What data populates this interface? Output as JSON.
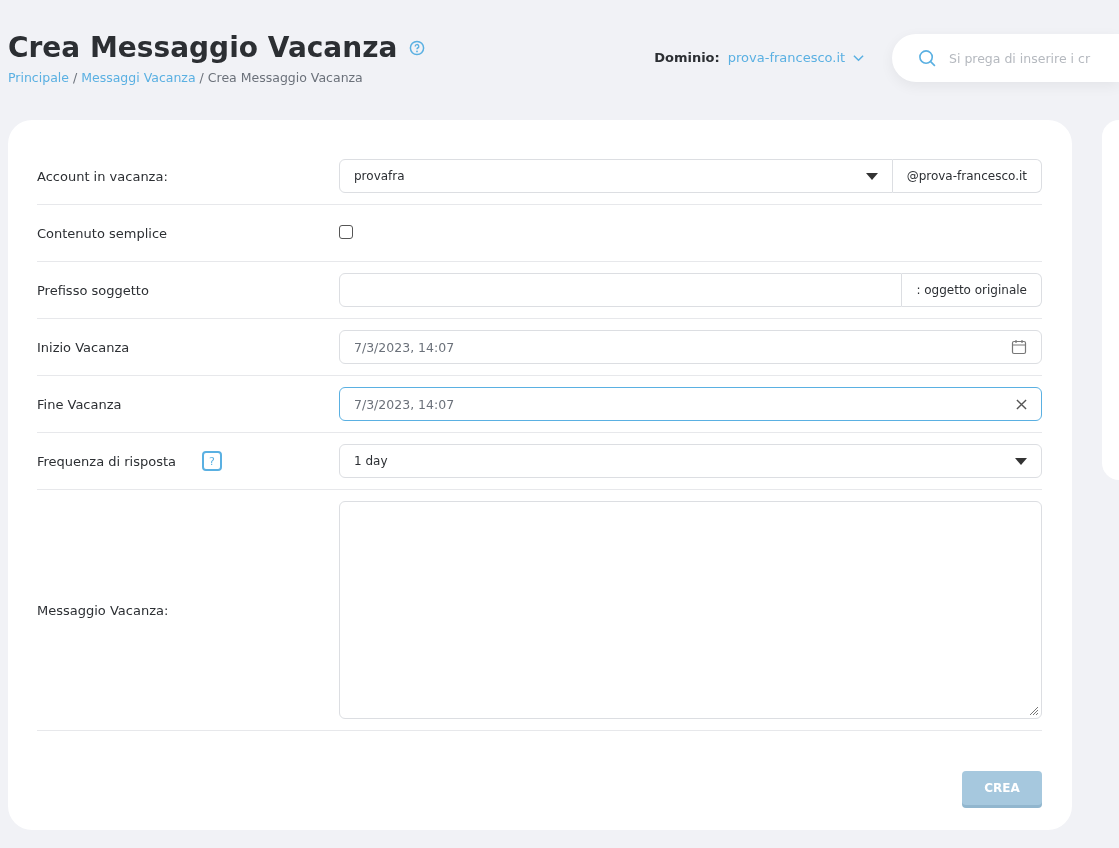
{
  "header": {
    "title": "Crea Messaggio Vacanza",
    "breadcrumbs": [
      {
        "label": "Principale",
        "link": true
      },
      {
        "separator": "/",
        "label": "Messaggi Vacanza",
        "link": true
      },
      {
        "separator": "/",
        "label": "Crea Messaggio Vacanza",
        "link": false
      }
    ],
    "domain_label": "Dominio:",
    "domain_value": "prova-francesco.it",
    "search": {
      "placeholder": "Si prega di inserire i cr"
    }
  },
  "form": {
    "rows": [
      {
        "kind": "select",
        "label": "Account in vacanza:",
        "value": "provafra",
        "addon": "@prova-francesco.it"
      },
      {
        "kind": "checkbox",
        "label": "Contenuto semplice",
        "checked": false
      },
      {
        "kind": "text",
        "label": "Prefisso soggetto",
        "value": "",
        "addon": ": oggetto originale"
      },
      {
        "kind": "datetime",
        "label": "Inizio Vacanza",
        "value": "7/3/2023, 14:07",
        "focused": false
      },
      {
        "kind": "datetime",
        "label": "Fine Vacanza",
        "value": "7/3/2023, 14:07",
        "focused": true
      },
      {
        "kind": "select",
        "label": "Frequenza di risposta",
        "value": "1 day",
        "help": "?"
      },
      {
        "kind": "textarea",
        "label": "Messaggio Vacanza:",
        "value": ""
      }
    ],
    "submit": {
      "label": "CREA",
      "disabled": true
    }
  }
}
